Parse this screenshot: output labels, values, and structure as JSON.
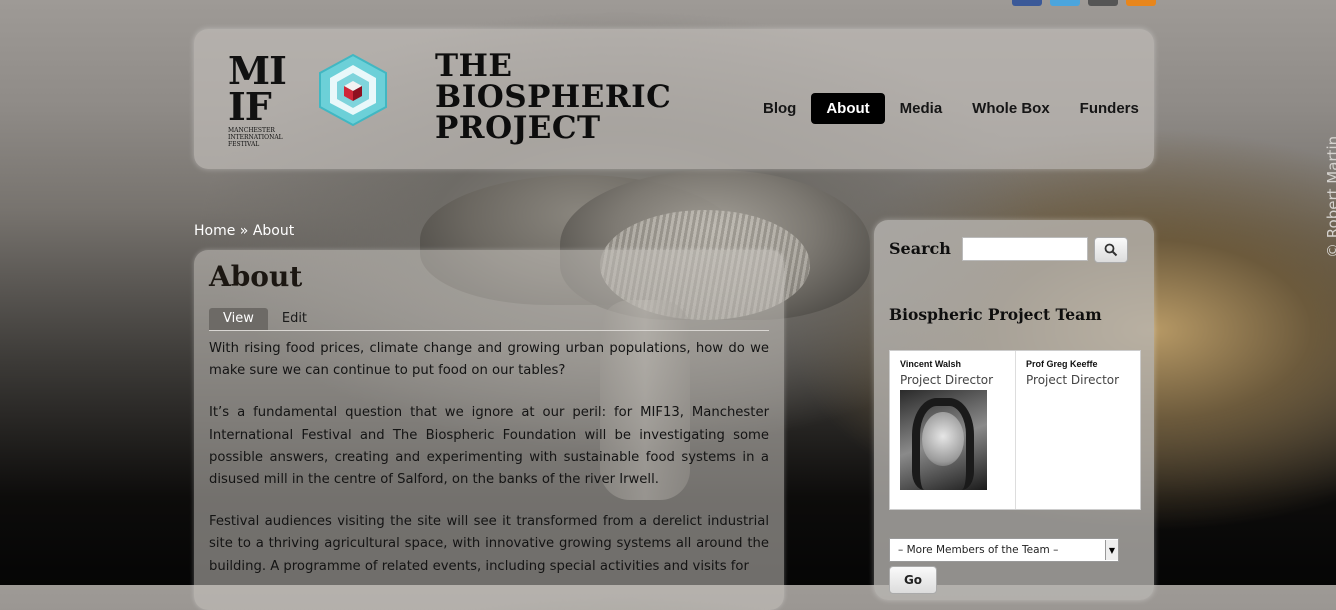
{
  "social": {
    "icons": [
      "facebook-icon",
      "twitter-icon",
      "google-icon",
      "rss-icon"
    ],
    "colors": [
      "#3b5998",
      "#4ba5dd",
      "#555555",
      "#e8861c"
    ]
  },
  "header": {
    "logo_mif": {
      "letters_top": "MI",
      "letters_bottom": "IF",
      "small": "MANCHESTER INTERNATIONAL FESTIVAL"
    },
    "site_title_lines": [
      "THE",
      "BIOSPHERIC",
      "PROJECT"
    ]
  },
  "nav": [
    {
      "label": "Blog",
      "active": false
    },
    {
      "label": "About",
      "active": true
    },
    {
      "label": "Media",
      "active": false
    },
    {
      "label": "Whole Box",
      "active": false
    },
    {
      "label": "Funders",
      "active": false
    }
  ],
  "breadcrumb": {
    "home": "Home",
    "sep": " » ",
    "current": "About"
  },
  "main": {
    "title": "About",
    "tabs": [
      {
        "label": "View",
        "active": true
      },
      {
        "label": "Edit",
        "active": false
      }
    ],
    "paragraphs": [
      "With rising food prices, climate change and growing urban populations, how do we make sure we can continue to put food on our tables?",
      "It’s a fundamental question that we ignore at our peril: for MIF13, Manchester International Festival and The Biospheric Foundation will be investigating some possible answers, creating and experimenting with sustainable food systems in a disused mill in the centre of Salford, on the banks of the river Irwell.",
      "Festival audiences visiting the site will see it transformed from a derelict industrial site to a thriving agricultural space, with innovative growing systems all around the building. A programme of related events, including special activities and visits for"
    ]
  },
  "sidebar": {
    "search_label": "Search",
    "search_value": "",
    "team_title": "Biospheric Project Team",
    "members": [
      {
        "name": "Vincent Walsh",
        "role": "Project Director",
        "has_photo": true
      },
      {
        "name": "Prof Greg Keeffe",
        "role": "Project Director",
        "has_photo": false
      }
    ],
    "select_value": "– More Members of the Team –",
    "go_label": "Go"
  },
  "credit": "© Robert Martin"
}
